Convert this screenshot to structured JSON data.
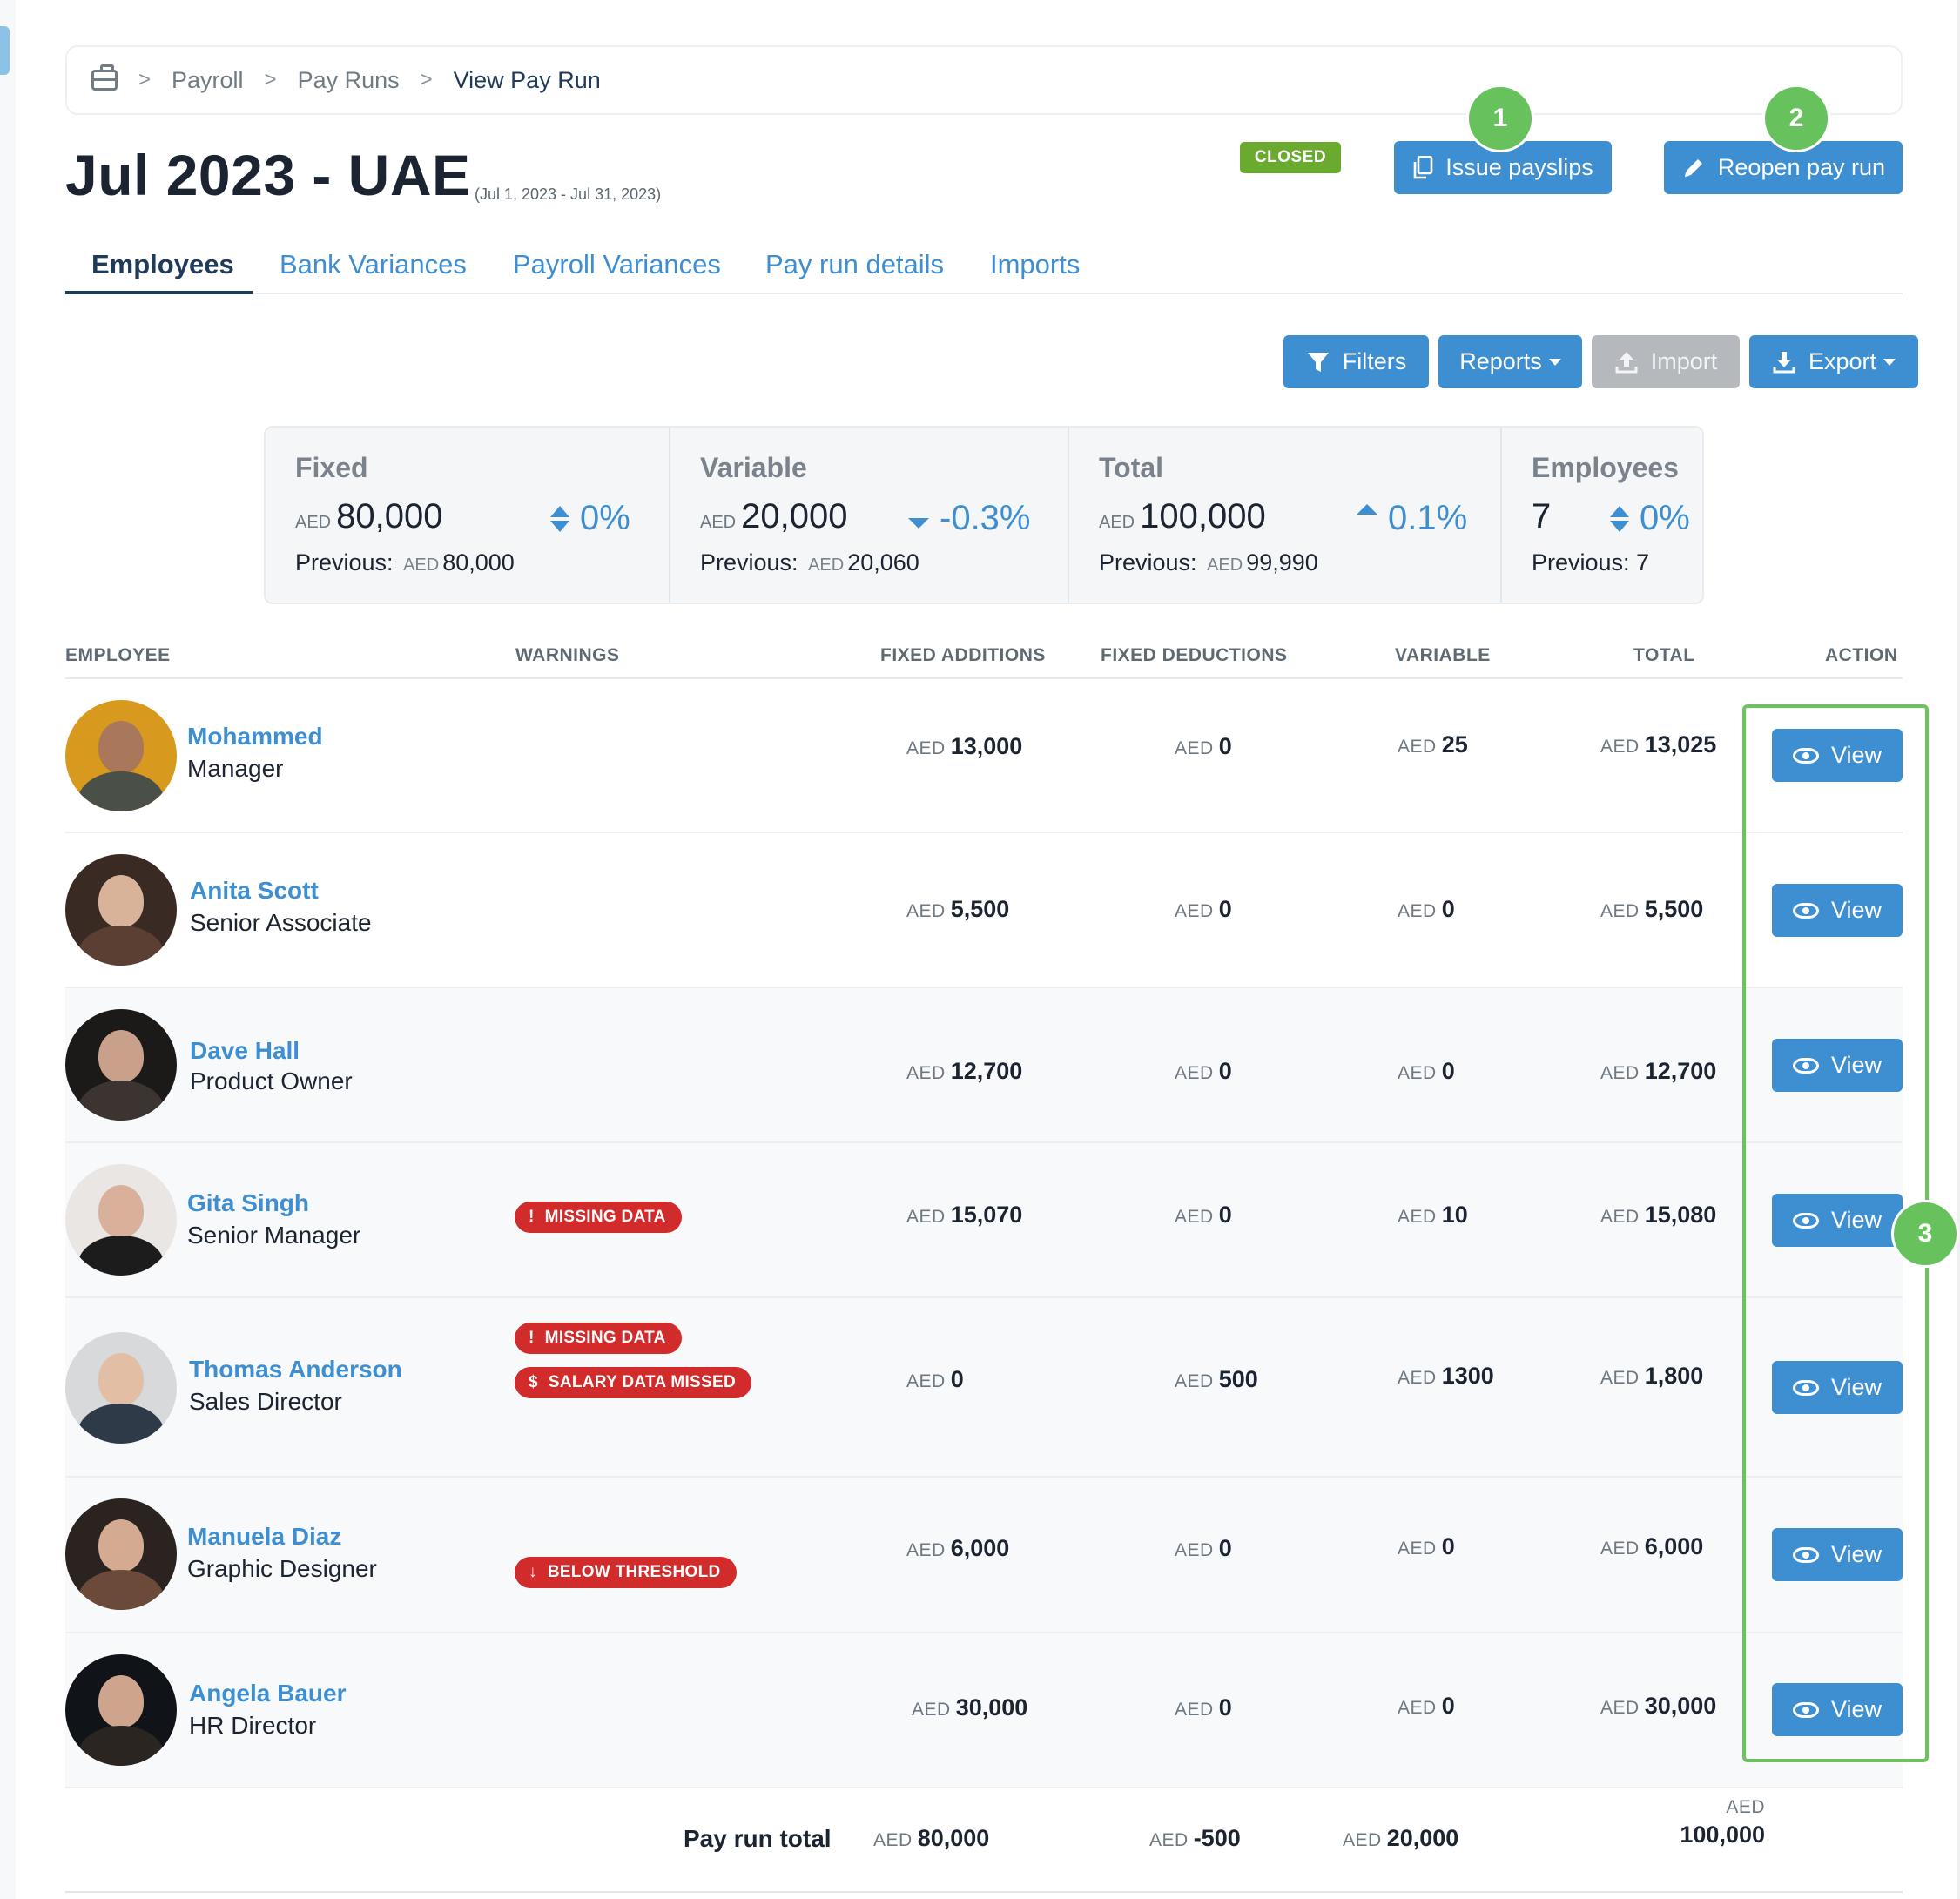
{
  "breadcrumb": {
    "home_icon": "briefcase-icon",
    "items": [
      "Payroll",
      "Pay Runs",
      "View Pay Run"
    ]
  },
  "header": {
    "title": "Jul 2023 - UAE",
    "dates": "(Jul 1, 2023 - Jul 31, 2023)",
    "status": "CLOSED",
    "issue_label": "Issue payslips",
    "reopen_label": "Reopen pay run"
  },
  "steps": [
    "1",
    "2",
    "3"
  ],
  "tabs": [
    "Employees",
    "Bank Variances",
    "Payroll Variances",
    "Pay run details",
    "Imports"
  ],
  "toolbar": {
    "filters": "Filters",
    "reports": "Reports",
    "import": "Import",
    "export": "Export"
  },
  "summary": {
    "fixed": {
      "label": "Fixed",
      "currency": "AED",
      "value": "80,000",
      "change": "0%",
      "prev_label": "Previous:",
      "prev_currency": "AED",
      "prev_value": "80,000"
    },
    "variable": {
      "label": "Variable",
      "currency": "AED",
      "value": "20,000",
      "change": "-0.3%",
      "prev_label": "Previous:",
      "prev_currency": "AED",
      "prev_value": "20,060"
    },
    "total": {
      "label": "Total",
      "currency": "AED",
      "value": "100,000",
      "change": "0.1%",
      "prev_label": "Previous:",
      "prev_currency": "AED",
      "prev_value": "99,990"
    },
    "employees": {
      "label": "Employees",
      "value": "7",
      "change": "0%",
      "prev_label": "Previous:",
      "prev_value": "7"
    }
  },
  "table": {
    "columns": [
      "EMPLOYEE",
      "WARNINGS",
      "FIXED ADDITIONS",
      "FIXED DEDUCTIONS",
      "VARIABLE",
      "TOTAL",
      "ACTION"
    ],
    "currency": "AED",
    "view_label": "View",
    "rows": [
      {
        "name": "Mohammed",
        "role": "Manager",
        "warnings": [],
        "fixed_add": "13,000",
        "fixed_ded": "0",
        "variable": "25",
        "total": "13,025"
      },
      {
        "name": "Anita Scott",
        "role": "Senior Associate",
        "warnings": [],
        "fixed_add": "5,500",
        "fixed_ded": "0",
        "variable": "0",
        "total": "5,500"
      },
      {
        "name": "Dave Hall",
        "role": "Product Owner",
        "warnings": [],
        "fixed_add": "12,700",
        "fixed_ded": "0",
        "variable": "0",
        "total": "12,700"
      },
      {
        "name": "Gita Singh",
        "role": "Senior Manager",
        "warnings": [
          "MISSING DATA"
        ],
        "fixed_add": "15,070",
        "fixed_ded": "0",
        "variable": "10",
        "total": "15,080"
      },
      {
        "name": "Thomas Anderson",
        "role": "Sales Director",
        "warnings": [
          "MISSING DATA",
          "SALARY DATA MISSED"
        ],
        "fixed_add": "0",
        "fixed_ded": "500",
        "variable": "1300",
        "total": "1,800"
      },
      {
        "name": "Manuela Diaz",
        "role": "Graphic Designer",
        "warnings": [
          "BELOW THRESHOLD"
        ],
        "fixed_add": "6,000",
        "fixed_ded": "0",
        "variable": "0",
        "total": "6,000"
      },
      {
        "name": "Angela Bauer",
        "role": "HR Director",
        "warnings": [],
        "fixed_add": "30,000",
        "fixed_ded": "0",
        "variable": "0",
        "total": "30,000"
      }
    ],
    "totals": {
      "label": "Pay run total",
      "fixed_add": "80,000",
      "fixed_ded": "-500",
      "variable": "20,000",
      "total": "100,000"
    }
  },
  "colors": {
    "accent": "#3e8ed2",
    "closed": "#6aaa2f",
    "warning": "#d22b2b",
    "step": "#67c25d"
  }
}
